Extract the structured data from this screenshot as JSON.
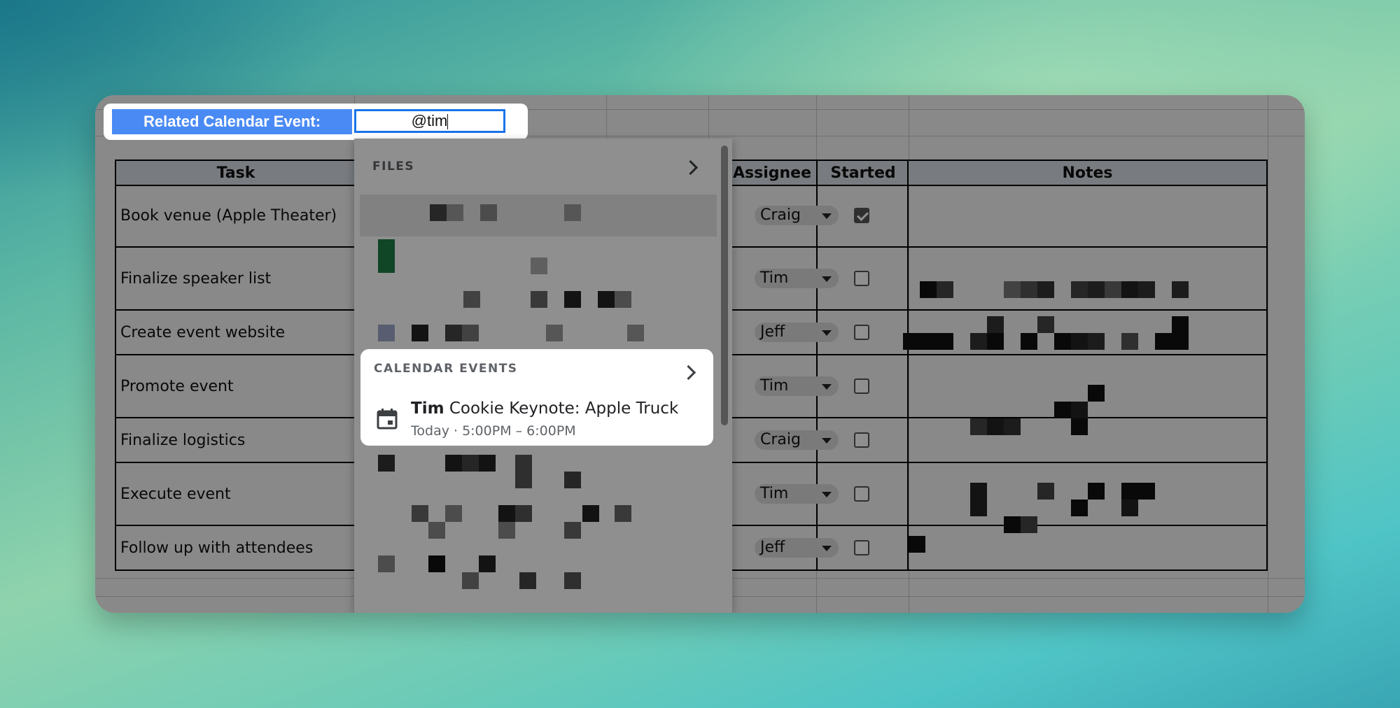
{
  "header": {
    "label": "Related Calendar Event:",
    "input_value": "@tim"
  },
  "table": {
    "columns": [
      "Task",
      "Assignee",
      "Started",
      "Notes"
    ],
    "rows": [
      {
        "task": "Book venue (Apple Theater)",
        "assignee": "Craig",
        "started": true
      },
      {
        "task": "Finalize speaker list",
        "assignee": "Tim",
        "started": false
      },
      {
        "task": "Create event website",
        "assignee": "Jeff",
        "started": false
      },
      {
        "task": "Promote event",
        "assignee": "Tim",
        "started": false
      },
      {
        "task": "Finalize logistics",
        "assignee": "Craig",
        "started": false
      },
      {
        "task": "Execute event",
        "assignee": "Tim",
        "started": false
      },
      {
        "task": "Follow up with attendees",
        "assignee": "Jeff",
        "started": false
      }
    ]
  },
  "dropdown": {
    "files_section": "FILES",
    "calendar_section": "CALENDAR EVENTS",
    "event": {
      "title_bold": "Tim",
      "title_rest": " Cookie Keynote: Apple Truck",
      "subtitle": "Today · 5:00PM – 6:00PM"
    }
  },
  "colors": {
    "accent_blue": "#4a8af4",
    "focus_border": "#1a73e8",
    "calendar_icon": "#3c4043"
  },
  "icons": [
    "chevron-right-icon",
    "calendar-icon",
    "dropdown-caret-icon",
    "checkmark-icon"
  ]
}
